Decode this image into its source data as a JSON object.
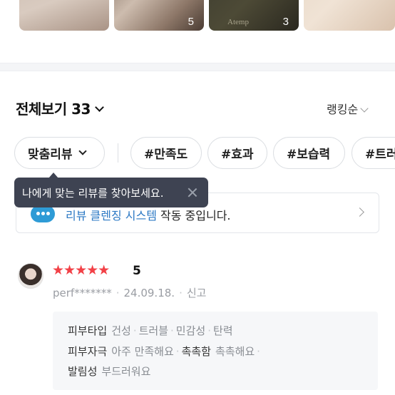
{
  "photos": {
    "counts": [
      "5",
      "3"
    ],
    "brand_text": "Atemp"
  },
  "header": {
    "total_label": "전체보기 33",
    "sort_label": "랭킹순"
  },
  "chips": {
    "main": "맞춤리뷰",
    "tags": [
      "#만족도",
      "#효과",
      "#보습력",
      "#트러"
    ]
  },
  "tooltip": {
    "text": "나에게 맞는 리뷰를 찾아보세요."
  },
  "notice": {
    "highlight": "리뷰 클렌징 시스템",
    "rest": " 작동 중입니다."
  },
  "review": {
    "stars": "★★★★★",
    "rating": 5,
    "score_label": "5",
    "author": "perf*******",
    "date": "24.09.18.",
    "report_label": "신고",
    "attributes": [
      {
        "label": "피부타입",
        "values": [
          "건성",
          "트러블",
          "민감성",
          "탄력"
        ]
      },
      {
        "label": "피부자극",
        "values": [
          "아주 만족해요"
        ],
        "label2": "촉촉함",
        "values2": [
          "촉촉해요"
        ]
      },
      {
        "label": "발림성",
        "values": [
          "부드러워요"
        ]
      }
    ]
  },
  "colors": {
    "star": "#f24147",
    "tooltip_bg": "#3e4352",
    "notice_highlight": "#2b78c4",
    "icon_blue": "#2e9bd6"
  }
}
